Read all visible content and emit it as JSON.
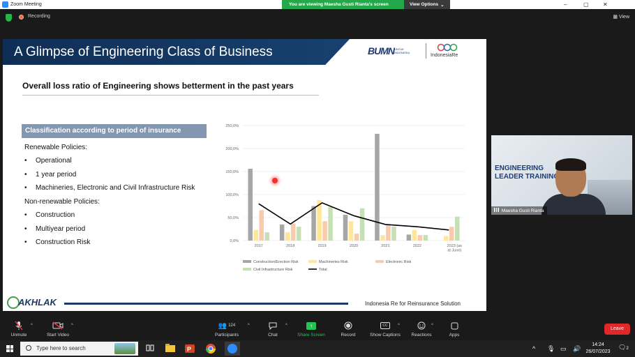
{
  "window": {
    "title": "Zoom Meeting",
    "share_banner": "You are viewing Maesha Gusti Rianta's screen",
    "view_options": "View Options",
    "controls": [
      "–",
      "▢",
      "✕"
    ]
  },
  "meeting_bar": {
    "recording": "Recording",
    "view": "View"
  },
  "slide": {
    "title": "A Glimpse of Engineering Class of Business",
    "logo_bumn": "BUMN",
    "logo_bumn_sub": "UNTUK INDONESIA",
    "logo_ire": "IndonesiaRe",
    "subtitle": "Overall loss ratio of Engineering shows betterment in the past years",
    "classification_header": "Classification according to period of insurance",
    "renewable_label": "Renewable Policies:",
    "renewable_items": [
      "Operational",
      "1 year period",
      "Machineries, Electronic and Civil Infrastructure Risk"
    ],
    "nonrenewable_label": "Non-renewable Policies:",
    "nonrenewable_items": [
      "Construction",
      "Multiyear period",
      "Construction Risk"
    ],
    "bullet": "•",
    "footer_text": "Indonesia Re for Reinsurance Solution",
    "akhlak": "AKHLAK"
  },
  "chart_data": {
    "type": "bar",
    "categories": [
      "2017",
      "2018",
      "2019",
      "2020",
      "2021",
      "2022",
      "2023 (as at June)"
    ],
    "y_ticks": [
      "250,0%",
      "200,0%",
      "150,0%",
      "100,0%",
      "50,0%",
      "0,0%"
    ],
    "ylim": [
      0,
      250
    ],
    "grid": true,
    "legend_position": "bottom",
    "series": [
      {
        "name": "Construction/Erection Risk",
        "color": "#a6a6a6",
        "values": [
          156,
          35,
          75,
          56,
          232,
          13,
          0
        ]
      },
      {
        "name": "Machineries Risk",
        "color": "#ffe699",
        "values": [
          23,
          18,
          88,
          42,
          12,
          23,
          10
        ]
      },
      {
        "name": "Electronic Risk",
        "color": "#f8cbad",
        "values": [
          66,
          37,
          42,
          15,
          35,
          12,
          30
        ]
      },
      {
        "name": "Civil Infrastructure Risk",
        "color": "#c5e0b4",
        "values": [
          18,
          30,
          73,
          70,
          30,
          12,
          52
        ]
      },
      {
        "name": "Total",
        "color": "#000000",
        "type": "line",
        "values": [
          80,
          36,
          82,
          54,
          35,
          30,
          23
        ]
      }
    ]
  },
  "video": {
    "name": "Maesha Gusti Rianta",
    "overlay_title_line1": "ENGINEERING",
    "overlay_title_line2": "LEADER TRAINING"
  },
  "toolbar": {
    "unmute": "Unmute",
    "start_video": "Start Video",
    "participants": "Participants",
    "participants_count": "124",
    "chat": "Chat",
    "share_screen": "Share Screen",
    "record": "Record",
    "show_captions": "Show Captions",
    "reactions": "Reactions",
    "apps": "Apps",
    "leave": "Leave"
  },
  "taskbar": {
    "search_placeholder": "Type here to search",
    "time": "14:24",
    "date": "26/07/2023",
    "notifications": "2"
  }
}
